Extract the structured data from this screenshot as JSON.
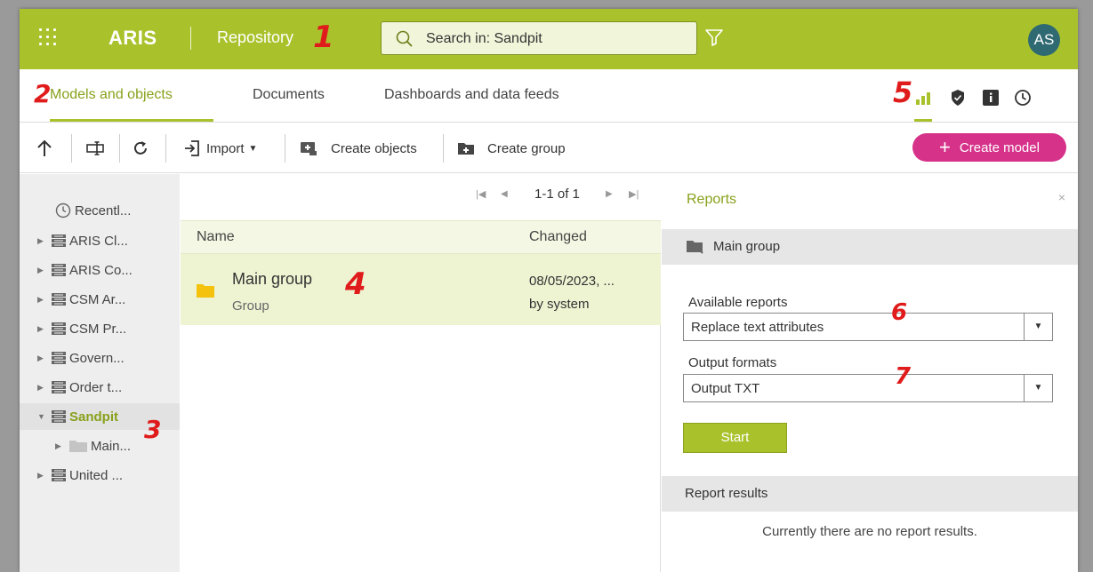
{
  "header": {
    "brand": "ARIS",
    "section": "Repository",
    "search_placeholder": "Search in: Sandpit",
    "avatar_initials": "AS",
    "accent_color": "#a9c22c"
  },
  "tabs": [
    {
      "label": "Models and objects",
      "active": true
    },
    {
      "label": "Documents",
      "active": false
    },
    {
      "label": "Dashboards and data feeds",
      "active": false
    }
  ],
  "toolbar": {
    "import_label": "Import",
    "create_objects_label": "Create objects",
    "create_group_label": "Create group",
    "create_model_label": "Create model",
    "create_model_color": "#d6328a"
  },
  "tree": [
    {
      "label": "Recentl..."
    },
    {
      "label": "ARIS Cl..."
    },
    {
      "label": "ARIS Co..."
    },
    {
      "label": "CSM Ar..."
    },
    {
      "label": "CSM Pr..."
    },
    {
      "label": "Govern..."
    },
    {
      "label": "Order t..."
    },
    {
      "label": "Sandpit",
      "selected": true
    },
    {
      "label": "Main..."
    },
    {
      "label": "United ..."
    }
  ],
  "list": {
    "pager": "1-1 of 1",
    "columns": {
      "name": "Name",
      "changed": "Changed"
    },
    "rows": [
      {
        "name": "Main group",
        "type": "Group",
        "changed_date": "08/05/2023, ...",
        "changed_by": "by system"
      }
    ]
  },
  "reports": {
    "title": "Reports",
    "close": "×",
    "context": "Main group",
    "available_label": "Available reports",
    "available_value": "Replace text attributes",
    "formats_label": "Output formats",
    "formats_value": "Output TXT",
    "start_label": "Start",
    "results_label": "Report results",
    "results_empty": "Currently there are no report results."
  },
  "annotations": [
    "1",
    "2",
    "3",
    "4",
    "5",
    "6",
    "7"
  ]
}
